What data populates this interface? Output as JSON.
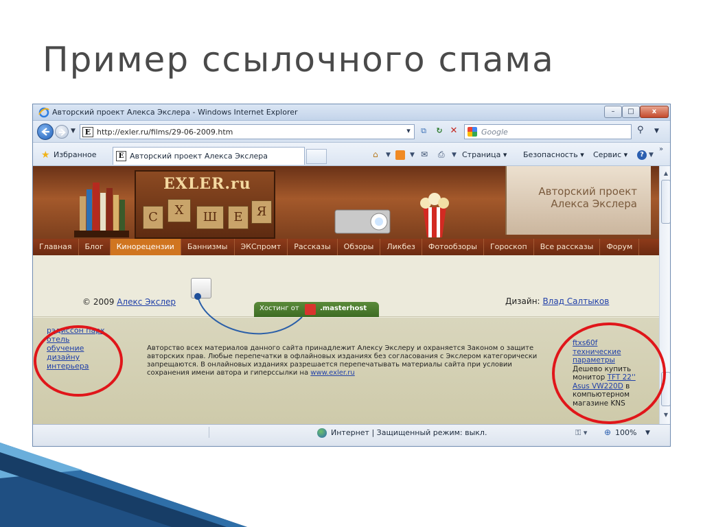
{
  "slide": {
    "title": "Пример ссылочного спама"
  },
  "window": {
    "title": "Авторский проект Алекса Экслера - Windows Internet Explorer",
    "controls": {
      "minimize": "–",
      "maximize": "□",
      "close": "x"
    }
  },
  "address_bar": {
    "url": "http://exler.ru/films/29-06-2009.htm",
    "site_icon_letter": "E",
    "search_placeholder": "Google"
  },
  "toolbar": {
    "favorites_label": "Избранное",
    "tab_title": "Авторский проект Алекса Экслера",
    "tab_icon_letter": "E",
    "menus": {
      "page": "Страница ▾",
      "security": "Безопасность ▾",
      "tools": "Сервис ▾"
    }
  },
  "site": {
    "logo": "EXLER.ru",
    "logo_letters": [
      "С",
      "Х",
      "Ш",
      "Е",
      "Я"
    ],
    "banner_tagline": "Авторский проект\nАлекса Экслера",
    "nav": [
      {
        "label": "Главная",
        "active": false
      },
      {
        "label": "Блог",
        "active": false
      },
      {
        "label": "Кинорецензии",
        "active": true
      },
      {
        "label": "Баннизмы",
        "active": false
      },
      {
        "label": "ЭКСпромт",
        "active": false
      },
      {
        "label": "Рассказы",
        "active": false
      },
      {
        "label": "Обзоры",
        "active": false
      },
      {
        "label": "Ликбез",
        "active": false
      },
      {
        "label": "Фотообзоры",
        "active": false
      },
      {
        "label": "Гороскоп",
        "active": false
      },
      {
        "label": "Все рассказы",
        "active": false
      },
      {
        "label": "Форум",
        "active": false
      }
    ],
    "footer": {
      "copyright_prefix": "© 2009",
      "copyright_author": "Алекс Экслер",
      "design_prefix": "Дизайн:",
      "design_author": "Влад Салтыков",
      "hosting_label": "Хостинг от",
      "hosting_brand": ".masterhost",
      "rights_text": "Авторство всех материалов данного сайта принадлежит Алексу Экслеру и охраняется Законом о защите авторских прав. Любые перепечатки в офлайновых изданиях без согласования с Экслером категорически запрещаются. В онлайновых изданиях разрешается перепечатывать материалы сайта при условии сохранения имени автора и гиперссылки на",
      "rights_link": "www.exler.ru",
      "spam_left_links": [
        "рэдиссон парк",
        "отель",
        "обучение",
        "дизайну",
        "интерьера"
      ],
      "spam_right": {
        "link1": "ftxs60f",
        "link2": "технические",
        "link3": "параметры",
        "text1": "Дешево купить",
        "text2": "монитор",
        "link4": "TFT 22''",
        "link5": "Asus VW220D",
        "text3": "в",
        "text4": "компьютерном",
        "text5": "магазине KNS"
      }
    }
  },
  "status_bar": {
    "zone": "Интернет | Защищенный режим: выкл.",
    "zoom": "100%"
  },
  "colors": {
    "annotation_ring": "#e0161a",
    "nav_bg": "#7a3014",
    "nav_active": "#d07520",
    "link": "#1f3fa8"
  }
}
